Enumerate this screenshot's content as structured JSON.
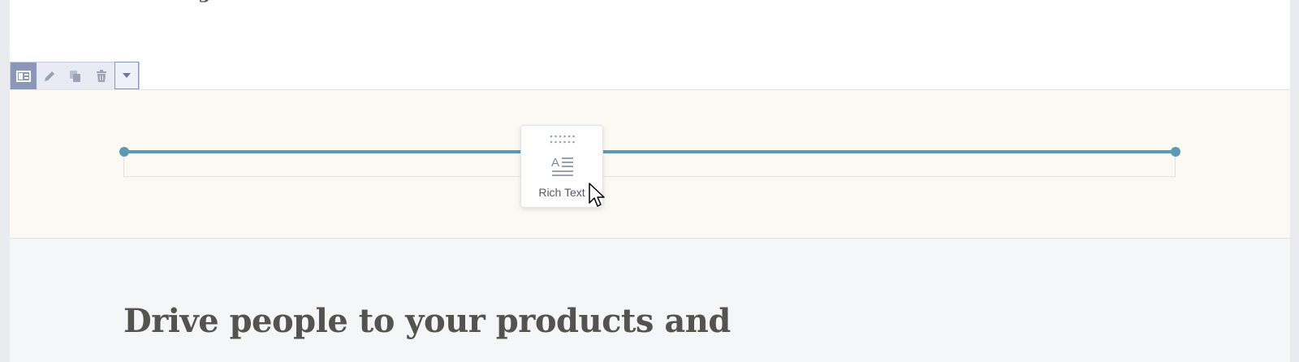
{
  "toolbar": {
    "buttons": [
      {
        "icon": "layout-icon",
        "active": true
      },
      {
        "icon": "pencil-icon",
        "active": false
      },
      {
        "icon": "duplicate-icon",
        "active": false
      },
      {
        "icon": "trash-icon",
        "active": false
      },
      {
        "icon": "chevron-down-icon",
        "active": false
      }
    ]
  },
  "popup": {
    "icon": "rich-text-icon",
    "label": "Rich Text"
  },
  "content": {
    "heading": "Drive people to your products and"
  },
  "colors": {
    "divider": "#5a9ab5",
    "band_background": "#fcf9f2",
    "toolbar_active": "#8a97b8",
    "heading_text": "#55534d"
  }
}
